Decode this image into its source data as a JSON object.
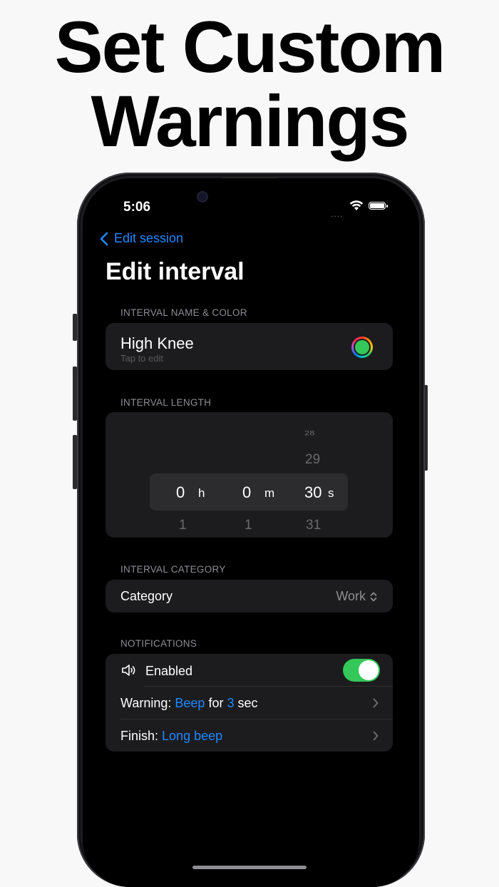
{
  "headline": {
    "line1": "Set Custom",
    "line2": "Warnings"
  },
  "status_bar": {
    "time": "5:06",
    "signal": "....",
    "wifi_icon": "wifi-icon",
    "battery_icon": "battery-icon"
  },
  "nav": {
    "back_label": "Edit session",
    "title": "Edit interval"
  },
  "name_section": {
    "label": "INTERVAL NAME & COLOR",
    "name": "High Knee",
    "hint": "Tap to edit",
    "color": "#34c759"
  },
  "length_section": {
    "label": "INTERVAL LENGTH",
    "hours": {
      "value": "0",
      "unit": "h",
      "next": "1"
    },
    "minutes": {
      "value": "0",
      "unit": "m",
      "next": "1"
    },
    "seconds": {
      "value": "30",
      "unit": "s",
      "prev2": "28",
      "prev": "29",
      "next": "31"
    }
  },
  "category_section": {
    "label": "INTERVAL CATEGORY",
    "row_label": "Category",
    "value": "Work"
  },
  "notifications_section": {
    "label": "NOTIFICATIONS",
    "enabled_label": "Enabled",
    "enabled": true,
    "warning": {
      "prefix": "Warning:",
      "sound": "Beep",
      "middle": "for",
      "seconds": "3",
      "suffix": "sec"
    },
    "finish": {
      "prefix": "Finish:",
      "sound": "Long beep"
    }
  },
  "colors": {
    "accent": "#1e88ff",
    "toggle_on": "#34c759",
    "card_bg": "#1c1c1e"
  }
}
